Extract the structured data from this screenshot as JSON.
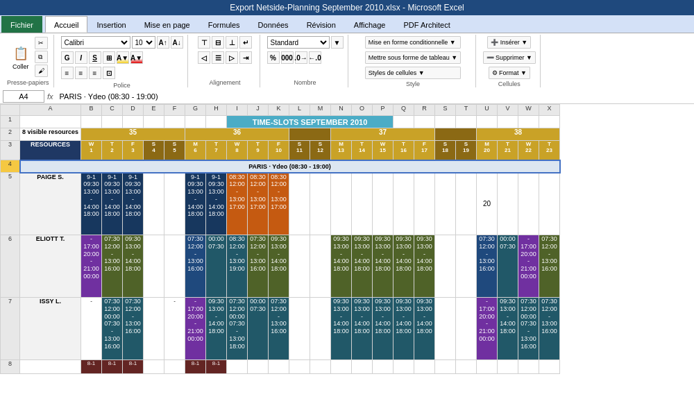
{
  "titlebar": {
    "text": "Export Netside-Planning September 2010.xlsx - Microsoft Excel"
  },
  "tabs": [
    {
      "label": "Fichier",
      "active": false,
      "special": "fichier"
    },
    {
      "label": "Accueil",
      "active": true
    },
    {
      "label": "Insertion",
      "active": false
    },
    {
      "label": "Mise en page",
      "active": false
    },
    {
      "label": "Formules",
      "active": false
    },
    {
      "label": "Données",
      "active": false
    },
    {
      "label": "Révision",
      "active": false
    },
    {
      "label": "Affichage",
      "active": false
    },
    {
      "label": "PDF Architect",
      "active": false
    }
  ],
  "formula_bar": {
    "cell_ref": "A4",
    "formula": "PARIS · Ydeo (08:30 - 19:00)"
  },
  "ribbon": {
    "groups": [
      {
        "label": "Presse-papiers",
        "icon": "📋"
      },
      {
        "label": "Police",
        "font": "Calibri",
        "size": "10"
      },
      {
        "label": "Alignement"
      },
      {
        "label": "Nombre",
        "format": "Standard"
      },
      {
        "label": "Style"
      },
      {
        "label": "Cellules"
      }
    ]
  },
  "sheet": {
    "title": "TIME-SLOTS SEPTEMBER 2010",
    "week_row": [
      {
        "week": "35",
        "cols": [
          "W\n1",
          "T\n2",
          "F\n3",
          "S\n4",
          "S\n5"
        ]
      },
      {
        "week": "36",
        "cols": [
          "M\n6",
          "T\n7",
          "W\n8",
          "T\n9",
          "F\n10"
        ]
      },
      {
        "week": "",
        "cols": [
          "S\n11",
          "S\n12"
        ]
      },
      {
        "week": "37",
        "cols": [
          "M\n13",
          "T\n14",
          "W\n15",
          "T\n16",
          "F\n17"
        ]
      },
      {
        "week": "",
        "cols": [
          "S\n18",
          "S\n19"
        ]
      },
      {
        "week": "38",
        "cols": [
          "M\n20",
          "T\n21",
          "W\n22",
          "T\n23"
        ]
      }
    ],
    "resources_label": "RESOURCES",
    "visible_resources": "8 visible resources",
    "paris_label": "PARIS · Ydeo (08:30 - 19:00)",
    "paige": {
      "name": "PAIGE S.",
      "cells": {
        "b": "9-1\n09:30\n13:00\n-\n14:00\n18:00",
        "c": "9-1\n09:30\n13:00\n-\n14:00\n18:00",
        "d": "9-1\n09:30\n13:00\n-\n14:00\n18:00",
        "g": "9-1\n09:30\n13:00\n-\n14:00\n18:00",
        "h": "9-1\n09:30\n13:00\n-\n14:00\n18:00",
        "i_orange": "08:30\n12:00\n-\n13:00\n17:00",
        "j_orange": "08:30\n12:00\n-\n13:00\n17:00",
        "k_orange": "08:30\n12:00\n-\n13:00\n17:00",
        "t20": "20"
      }
    },
    "eliott": {
      "name": "ELIOTT T.",
      "cells": {}
    },
    "issy": {
      "name": "ISSY L.",
      "cells": {}
    }
  }
}
